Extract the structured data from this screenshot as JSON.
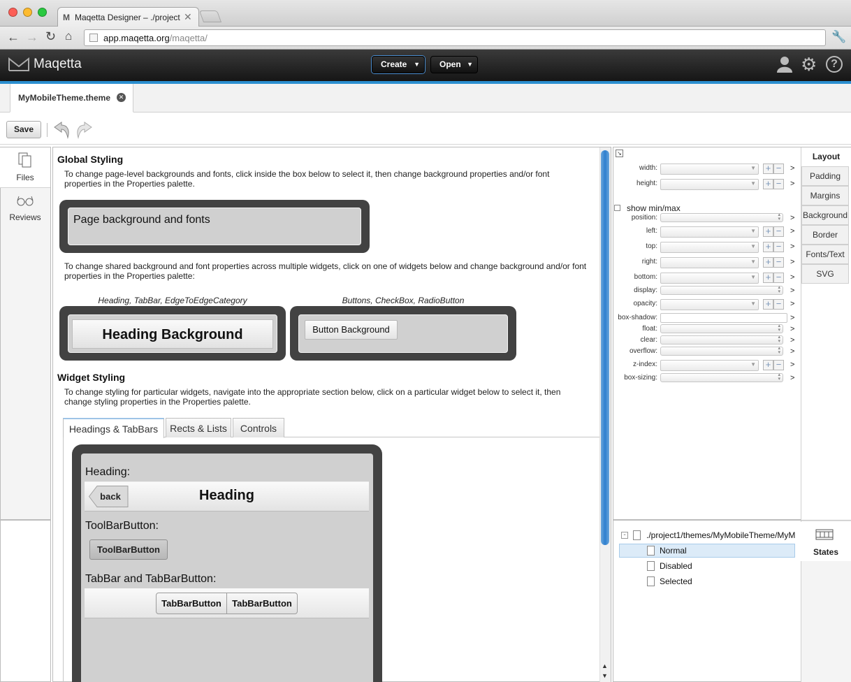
{
  "browser": {
    "tab_title": "Maqetta Designer – ./project",
    "url_host": "app.maqetta.org",
    "url_path": "/maqetta/"
  },
  "appbar": {
    "brand": "Maqetta",
    "create_label": "Create",
    "open_label": "Open"
  },
  "editor": {
    "doc_tab": "MyMobileTheme.theme",
    "save_label": "Save"
  },
  "left_sidebar": {
    "files": "Files",
    "reviews": "Reviews"
  },
  "canvas": {
    "global_heading": "Global Styling",
    "global_desc": "To change page-level backgrounds and fonts, click inside the box below to select it, then change background properties and/or font properties in the Properties palette.",
    "page_bg_label": "Page background and fonts",
    "shared_desc": "To change shared background and font properties across multiple widgets, click on one of widgets below and change background and/or font properties in the Properties palette:",
    "group1_caption": "Heading, TabBar, EdgeToEdgeCategory",
    "group2_caption": "Buttons, CheckBox, RadioButton",
    "heading_bg": "Heading Background",
    "button_bg": "Button Background",
    "widget_heading": "Widget Styling",
    "widget_desc": "To change styling for particular widgets, navigate into the appropriate section below, click on a particular widget below to select it, then change styling properties in the Properties palette.",
    "tabs": [
      "Headings & TabBars",
      "Rects & Lists",
      "Controls"
    ],
    "mobile": {
      "heading_label": "Heading:",
      "back": "back",
      "heading": "Heading",
      "toolbar_label": "ToolBarButton:",
      "toolbar_button": "ToolBarButton",
      "tabbar_label": "TabBar and TabBarButton:",
      "tabbar_buttons": [
        "TabBarButton",
        "TabBarButton"
      ]
    }
  },
  "properties": {
    "top_rows": [
      "width:",
      "height:"
    ],
    "show_minmax": "show min/max",
    "rows": [
      "position:",
      "left:",
      "top:",
      "right:",
      "bottom:",
      "display:",
      "opacity:",
      "box-shadow:",
      "float:",
      "clear:",
      "overflow:",
      "z-index:",
      "box-sizing:"
    ],
    "gt": ">",
    "plus": "+",
    "minus": "−",
    "tabs": [
      "Layout",
      "Padding",
      "Margins",
      "Background",
      "Border",
      "Fonts/Text",
      "SVG"
    ]
  },
  "states": {
    "path": "./project1/themes/MyMobileTheme/MyM",
    "items": [
      "Normal",
      "Disabled",
      "Selected"
    ],
    "tab_label": "States"
  },
  "colors": {
    "accent": "#2b8fd0",
    "selection": "#dcebf8"
  }
}
